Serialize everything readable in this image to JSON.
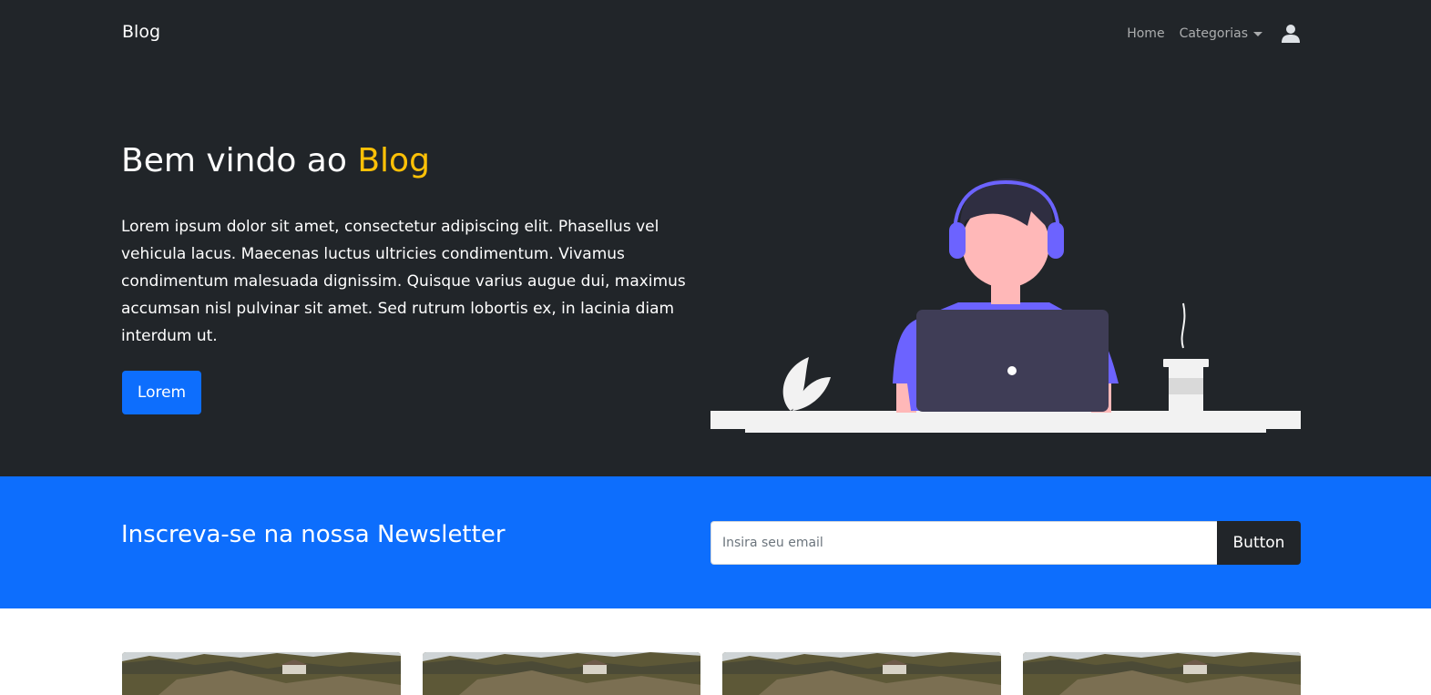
{
  "navbar": {
    "brand": "Blog",
    "links": [
      {
        "label": "Home"
      },
      {
        "label": "Categorias"
      }
    ],
    "user_icon": "user-icon"
  },
  "hero": {
    "title_prefix": "Bem vindo ao ",
    "title_accent": "Blog",
    "text": "Lorem ipsum dolor sit amet, consectetur adipiscing elit. Phasellus vel vehicula lacus. Maecenas luctus ultricies condimentum. Vivamus condimentum malesuada dignissim. Quisque varius augue dui, maximus accumsan nisl pulvinar sit amet. Sed rutrum lobortis ex, in lacinia diam interdum ut.",
    "button_label": "Lorem"
  },
  "newsletter": {
    "title": "Inscreva-se na nossa Newsletter",
    "email_placeholder": "Insira seu email",
    "button_label": "Button"
  },
  "colors": {
    "dark": "#212529",
    "primary": "#0d6efd",
    "accent": "#ffc107",
    "illustration_purple": "#6c63ff"
  }
}
